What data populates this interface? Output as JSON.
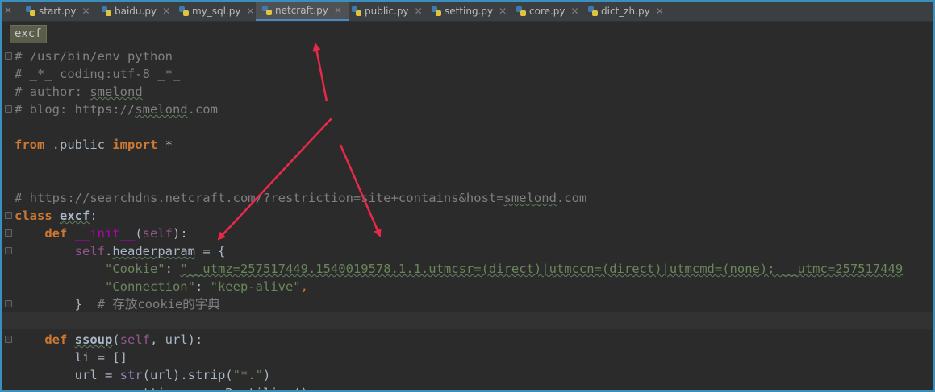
{
  "tabs": [
    {
      "label": "start.py"
    },
    {
      "label": "baidu.py"
    },
    {
      "label": "my_sql.py"
    },
    {
      "label": "netcraft.py"
    },
    {
      "label": "public.py"
    },
    {
      "label": "setting.py"
    },
    {
      "label": "core.py"
    },
    {
      "label": "dict_zh.py"
    }
  ],
  "active_tab": "netcraft.py",
  "search": {
    "text": "excf"
  },
  "code": {
    "l1": "# /usr/bin/env python",
    "l2": "# _*_ coding:utf-8 _*_",
    "l3a": "# author: ",
    "l3b": "smelond",
    "l4a": "# blog: https://",
    "l4b": "smelond",
    "l4c": ".com",
    "l6a": "from",
    "l6b": " .public ",
    "l6c": "import",
    "l6d": " *",
    "l9a": "# https://searchdns.netcraft.com/?restriction=site+contains&host=",
    "l9b": "smelond",
    "l9c": ".com",
    "l10a": "class",
    "l10b": " ",
    "l10c": "excf",
    "l10d": ":",
    "l11a": "    ",
    "l11b": "def",
    "l11c": " ",
    "l11d": "__init__",
    "l11e": "(",
    "l11f": "self",
    "l11g": "):",
    "l12a": "        ",
    "l12b": "self",
    "l12c": ".",
    "l12d": "headerparam",
    "l12e": " = {",
    "l13a": "            ",
    "l13b": "\"Cookie\"",
    "l13c": ": ",
    "l13d": "\"__utmz=257517449.1540019578.1.1.utmcsr=(direct)|utmccn=(direct)|utmcmd=(none); __utmc=257517449",
    "l14a": "            ",
    "l14b": "\"Connection\"",
    "l14c": ": ",
    "l14d": "\"keep-alive\"",
    "l14e": ",",
    "l15a": "        }  ",
    "l15b": "# 存放cookie的字典",
    "l17a": "    ",
    "l17b": "def",
    "l17c": " ",
    "l17d": "ssoup",
    "l17e": "(",
    "l17f": "self",
    "l17g": ", url):",
    "l18": "        li = []",
    "l19a": "        url = ",
    "l19b": "str",
    "l19c": "(url).strip(",
    "l19d": "\"*.\"",
    "l19e": ")",
    "l20": "        soup = setting.core.Reptilian()"
  },
  "colors": {
    "accent": "#4a88c7",
    "arrow": "#e8294a",
    "background": "#2b2b2b"
  }
}
